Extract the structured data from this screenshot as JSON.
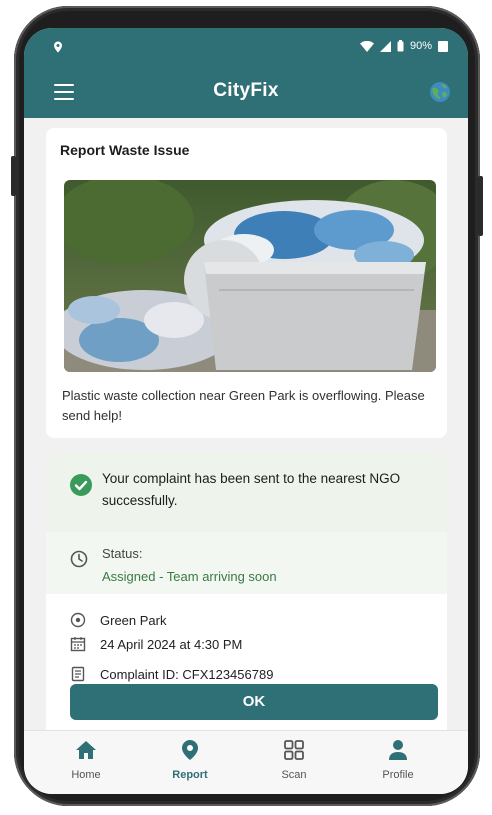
{
  "statusbar": {
    "battery": "90%"
  },
  "appbar": {
    "title": "CityFix"
  },
  "report_card": {
    "title": "Report Waste Issue",
    "description": "Plastic waste collection near Green Park is overflowing. Please send help!"
  },
  "confirmation": {
    "success_message": "Your complaint has been sent to the nearest NGO successfully.",
    "status_label": "Status:",
    "status_value": "Assigned - Team arriving soon",
    "location": "Green Park",
    "datetime": "24 April 2024 at 4:30 PM",
    "complaint_id": "Complaint ID: CFX123456789",
    "ok_label": "OK"
  },
  "bottom_nav": {
    "items": [
      {
        "label": "Home",
        "icon": "home-icon"
      },
      {
        "label": "Report",
        "icon": "location-pin-icon",
        "active": true
      },
      {
        "label": "Scan",
        "icon": "grid-icon"
      },
      {
        "label": "Profile",
        "icon": "person-icon"
      }
    ]
  },
  "colors": {
    "primary": "#2f6f76",
    "success": "#3a7a44",
    "success_bg": "#eef4ec"
  }
}
